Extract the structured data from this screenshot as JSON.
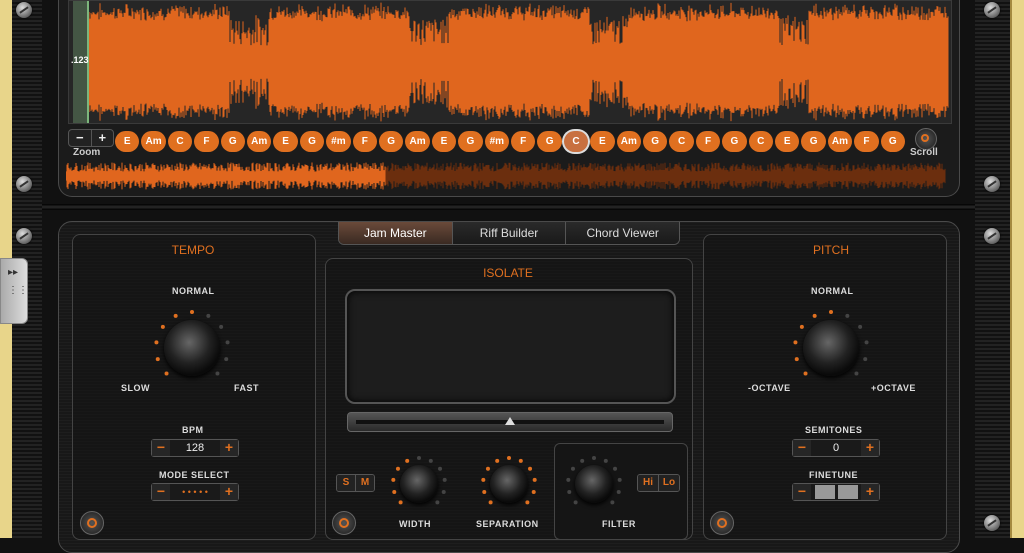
{
  "waveform": {
    "time_label": ".123"
  },
  "zoom": {
    "minus": "−",
    "plus": "+",
    "label": "Zoom"
  },
  "scroll": {
    "label": "Scroll"
  },
  "chords": [
    "E",
    "Am",
    "C",
    "F",
    "G",
    "Am",
    "E",
    "G",
    "#m",
    "F",
    "G",
    "Am",
    "E",
    "G",
    "#m",
    "F",
    "G",
    "C",
    "E",
    "Am",
    "G",
    "C",
    "F",
    "G",
    "C",
    "E",
    "G",
    "Am",
    "F",
    "G"
  ],
  "selected_chord_index": 17,
  "tabs": [
    {
      "label": "Jam Master",
      "active": true
    },
    {
      "label": "Riff Builder",
      "active": false
    },
    {
      "label": "Chord Viewer",
      "active": false
    }
  ],
  "tempo": {
    "title": "TEMPO",
    "knob_top": "NORMAL",
    "knob_left": "SLOW",
    "knob_right": "FAST",
    "bpm_label": "BPM",
    "bpm_value": "128",
    "mode_label": "MODE SELECT",
    "mode_value": "• • • • •"
  },
  "isolate": {
    "title": "ISOLATE",
    "s_label": "S",
    "m_label": "M",
    "width_label": "WIDTH",
    "separation_label": "SEPARATION",
    "filter_label": "FILTER",
    "hi_label": "Hi",
    "lo_label": "Lo",
    "slider_position": 0.5
  },
  "pitch": {
    "title": "PITCH",
    "knob_top": "NORMAL",
    "knob_left": "-OCTAVE",
    "knob_right": "+OCTAVE",
    "semitones_label": "SEMITONES",
    "semitones_value": "0",
    "finetune_label": "FINETUNE"
  },
  "stepper": {
    "minus": "−",
    "plus": "+"
  },
  "colors": {
    "accent": "#e07020",
    "waveform": "#e0661e",
    "background": "#1b1b1b"
  }
}
